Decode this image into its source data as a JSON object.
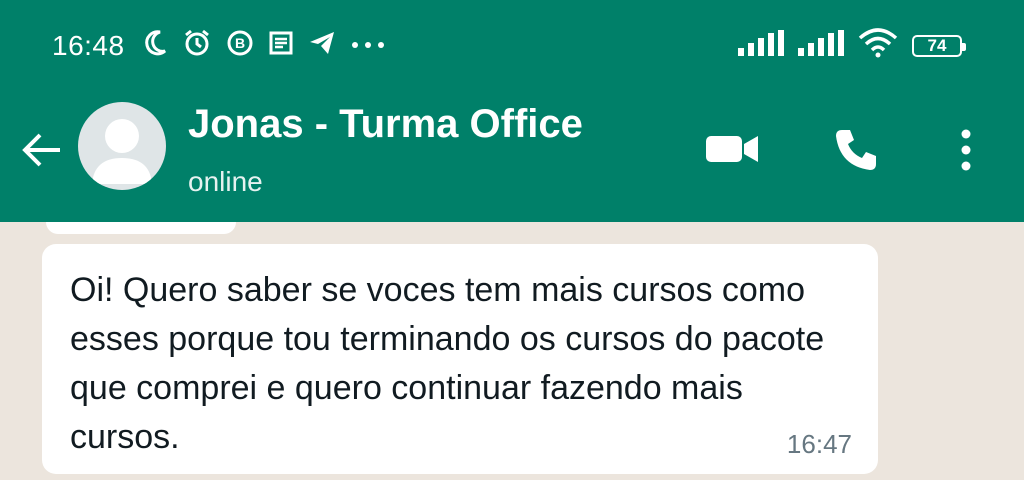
{
  "status_bar": {
    "time": "16:48",
    "battery": "74",
    "icons_left": [
      "moon-icon",
      "alarm-icon",
      "b-app-icon",
      "news-icon",
      "telegram-icon",
      "more-dots-icon"
    ],
    "icons_right": [
      "signal-icon",
      "signal-icon",
      "wifi-icon",
      "battery-icon"
    ]
  },
  "header": {
    "contact_name": "Jonas - Turma Office",
    "contact_status": "online",
    "actions": [
      "video-call-icon",
      "voice-call-icon",
      "menu-kebab-icon"
    ]
  },
  "messages": [
    {
      "text": "Oi! Quero saber se voces tem mais cursos como esses porque tou terminando os cursos do pacote que comprei e quero continuar fazendo mais cursos.",
      "time": "16:47"
    }
  ],
  "colors": {
    "header": "#008069",
    "chat_bg": "#ece5dd",
    "bubble": "#ffffff"
  }
}
